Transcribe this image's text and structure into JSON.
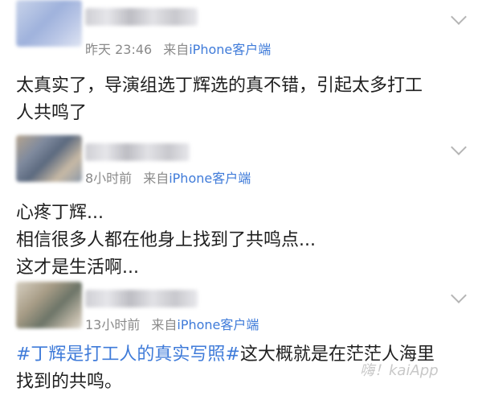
{
  "comments": [
    {
      "time": "昨天 23:46",
      "source_prefix": "来自",
      "source": "iPhone客户端",
      "lines": [
        "太真实了，导演组选丁辉选的真不错，引起太多打工",
        "人共鸣了"
      ]
    },
    {
      "time": "8小时前",
      "source_prefix": "来自",
      "source": "iPhone客户端",
      "lines": [
        "心疼丁辉...",
        "相信很多人都在他身上找到了共鸣点...",
        "这才是生活啊..."
      ]
    },
    {
      "time": "13小时前",
      "source_prefix": "来自",
      "source": "iPhone客户端",
      "hashtag": "#丁辉是打工人的真实写照#",
      "line1_rest": "这大概就是在茫茫人海里",
      "line2": "找到的共鸣。"
    }
  ],
  "watermark": "嗨！kaiApp",
  "icons": {
    "expand": "chevron-down-icon"
  }
}
